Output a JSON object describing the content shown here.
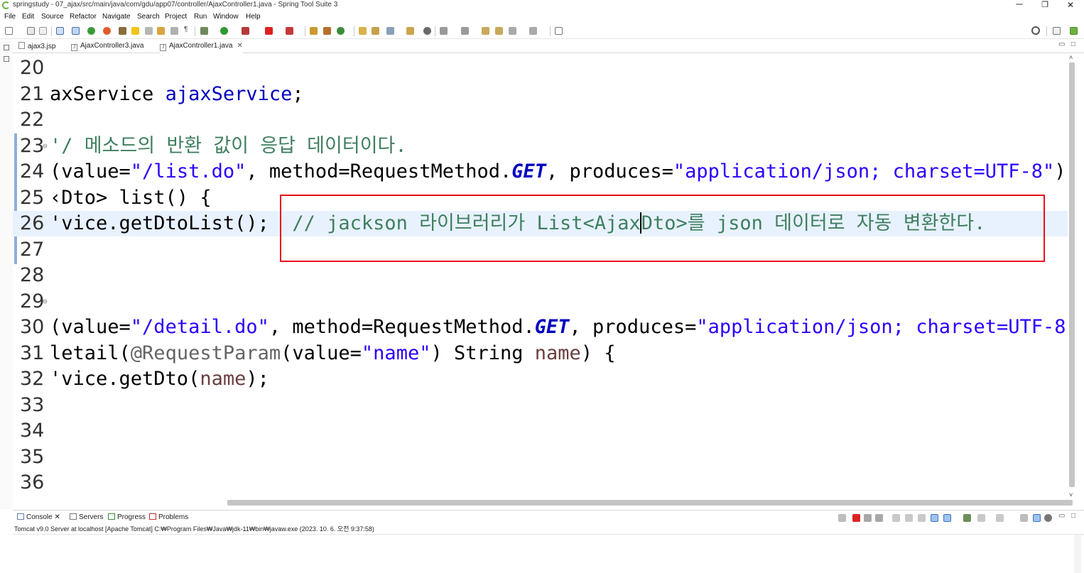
{
  "window": {
    "title": "springstudy - 07_ajax/src/main/java/com/gdu/app07/controller/AjaxController1.java - Spring Tool Suite 3",
    "minimize": "─",
    "restore": "❐",
    "close": "✕"
  },
  "menu": [
    "File",
    "Edit",
    "Source",
    "Refactor",
    "Navigate",
    "Search",
    "Project",
    "Run",
    "Window",
    "Help"
  ],
  "tabs": [
    {
      "label": "ajax3.jsp",
      "active": false,
      "closable": false
    },
    {
      "label": "AjaxController3.java",
      "active": false,
      "closable": false
    },
    {
      "label": "AjaxController1.java",
      "active": true,
      "closable": true
    }
  ],
  "editor": {
    "lines": [
      {
        "num": "20"
      },
      {
        "num": "21",
        "fold": ""
      },
      {
        "num": "22"
      },
      {
        "num": "23",
        "fold": "⊖"
      },
      {
        "num": "24"
      },
      {
        "num": "25"
      },
      {
        "num": "26"
      },
      {
        "num": "27"
      },
      {
        "num": "28"
      },
      {
        "num": "29",
        "fold": "⊖"
      },
      {
        "num": "30"
      },
      {
        "num": "31"
      },
      {
        "num": "32"
      },
      {
        "num": "33"
      },
      {
        "num": "34"
      },
      {
        "num": "35"
      },
      {
        "num": "36"
      }
    ],
    "code": {
      "l21_a": "axService ",
      "l21_b": "ajaxService",
      "l21_c": ";",
      "l23": "'/ 메소드의 반환 값이 응답 데이터이다.",
      "l24_a": "(value=",
      "l24_b": "\"/list.do\"",
      "l24_c": ", method=RequestMethod.",
      "l24_d": "GET",
      "l24_e": ", produces=",
      "l24_f": "\"application/json; charset=UTF-8\"",
      "l24_g": ")  /",
      "l25": "‹Dto> list() {",
      "l26_a": "'vice.getDtoList();  ",
      "l26_b": "// jackson 라이브러리가 List<Ajax",
      "l26_c": "Dto>를 json 데이터로 자동 변환한다.",
      "l30_a": "(value=",
      "l30_b": "\"/detail.do\"",
      "l30_c": ", method=RequestMethod.",
      "l30_d": "GET",
      "l30_e": ", produces=",
      "l30_f": "\"application/json; charset=UTF-8\"",
      "l30_g": ")",
      "l31_a": "letail(",
      "l31_b": "@RequestParam",
      "l31_c": "(value=",
      "l31_d": "\"name\"",
      "l31_e": ") String ",
      "l31_f": "name",
      "l31_g": ") {",
      "l32_a": "'vice.getDto(",
      "l32_b": "name",
      "l32_c": ");"
    }
  },
  "bottom_panel": {
    "tabs": [
      {
        "label": "Console",
        "closable": true
      },
      {
        "label": "Servers"
      },
      {
        "label": "Progress"
      },
      {
        "label": "Problems"
      }
    ],
    "close_glyph": "✕",
    "status": "Tomcat v9.0 Server at localhost [Apache Tomcat] C:₩Program Files₩Java₩jdk-11₩bin₩javaw.exe  (2023. 10. 6. 오전 9:37:58)"
  },
  "colors": {
    "highlight_box": "#e8101c",
    "string": "#2a00ff",
    "field": "#0000c0",
    "comment": "#3f7f5f",
    "current_line": "#e8f2fe"
  },
  "icons": {
    "search": "search-icon",
    "perspective": "perspective-icon"
  }
}
